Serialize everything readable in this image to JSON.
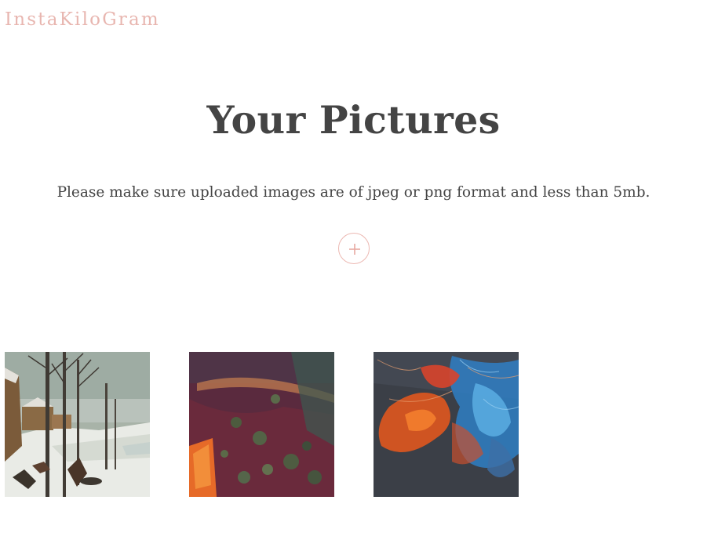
{
  "brand": {
    "name": "InstaKiloGram"
  },
  "page": {
    "title": "Your Pictures",
    "subtitle": "Please make sure uploaded images are of jpeg or png format and less than 5mb."
  },
  "upload": {
    "icon": "plus-icon"
  },
  "colors": {
    "brand": "#e8b6b0",
    "text": "#444444",
    "accent_border": "#ecb8b2",
    "background": "#ffffff"
  },
  "gallery": {
    "items": [
      {
        "subject": "winter landscape painting"
      },
      {
        "subject": "dark red abstract painting"
      },
      {
        "subject": "colorful ink smoke abstract"
      }
    ]
  }
}
